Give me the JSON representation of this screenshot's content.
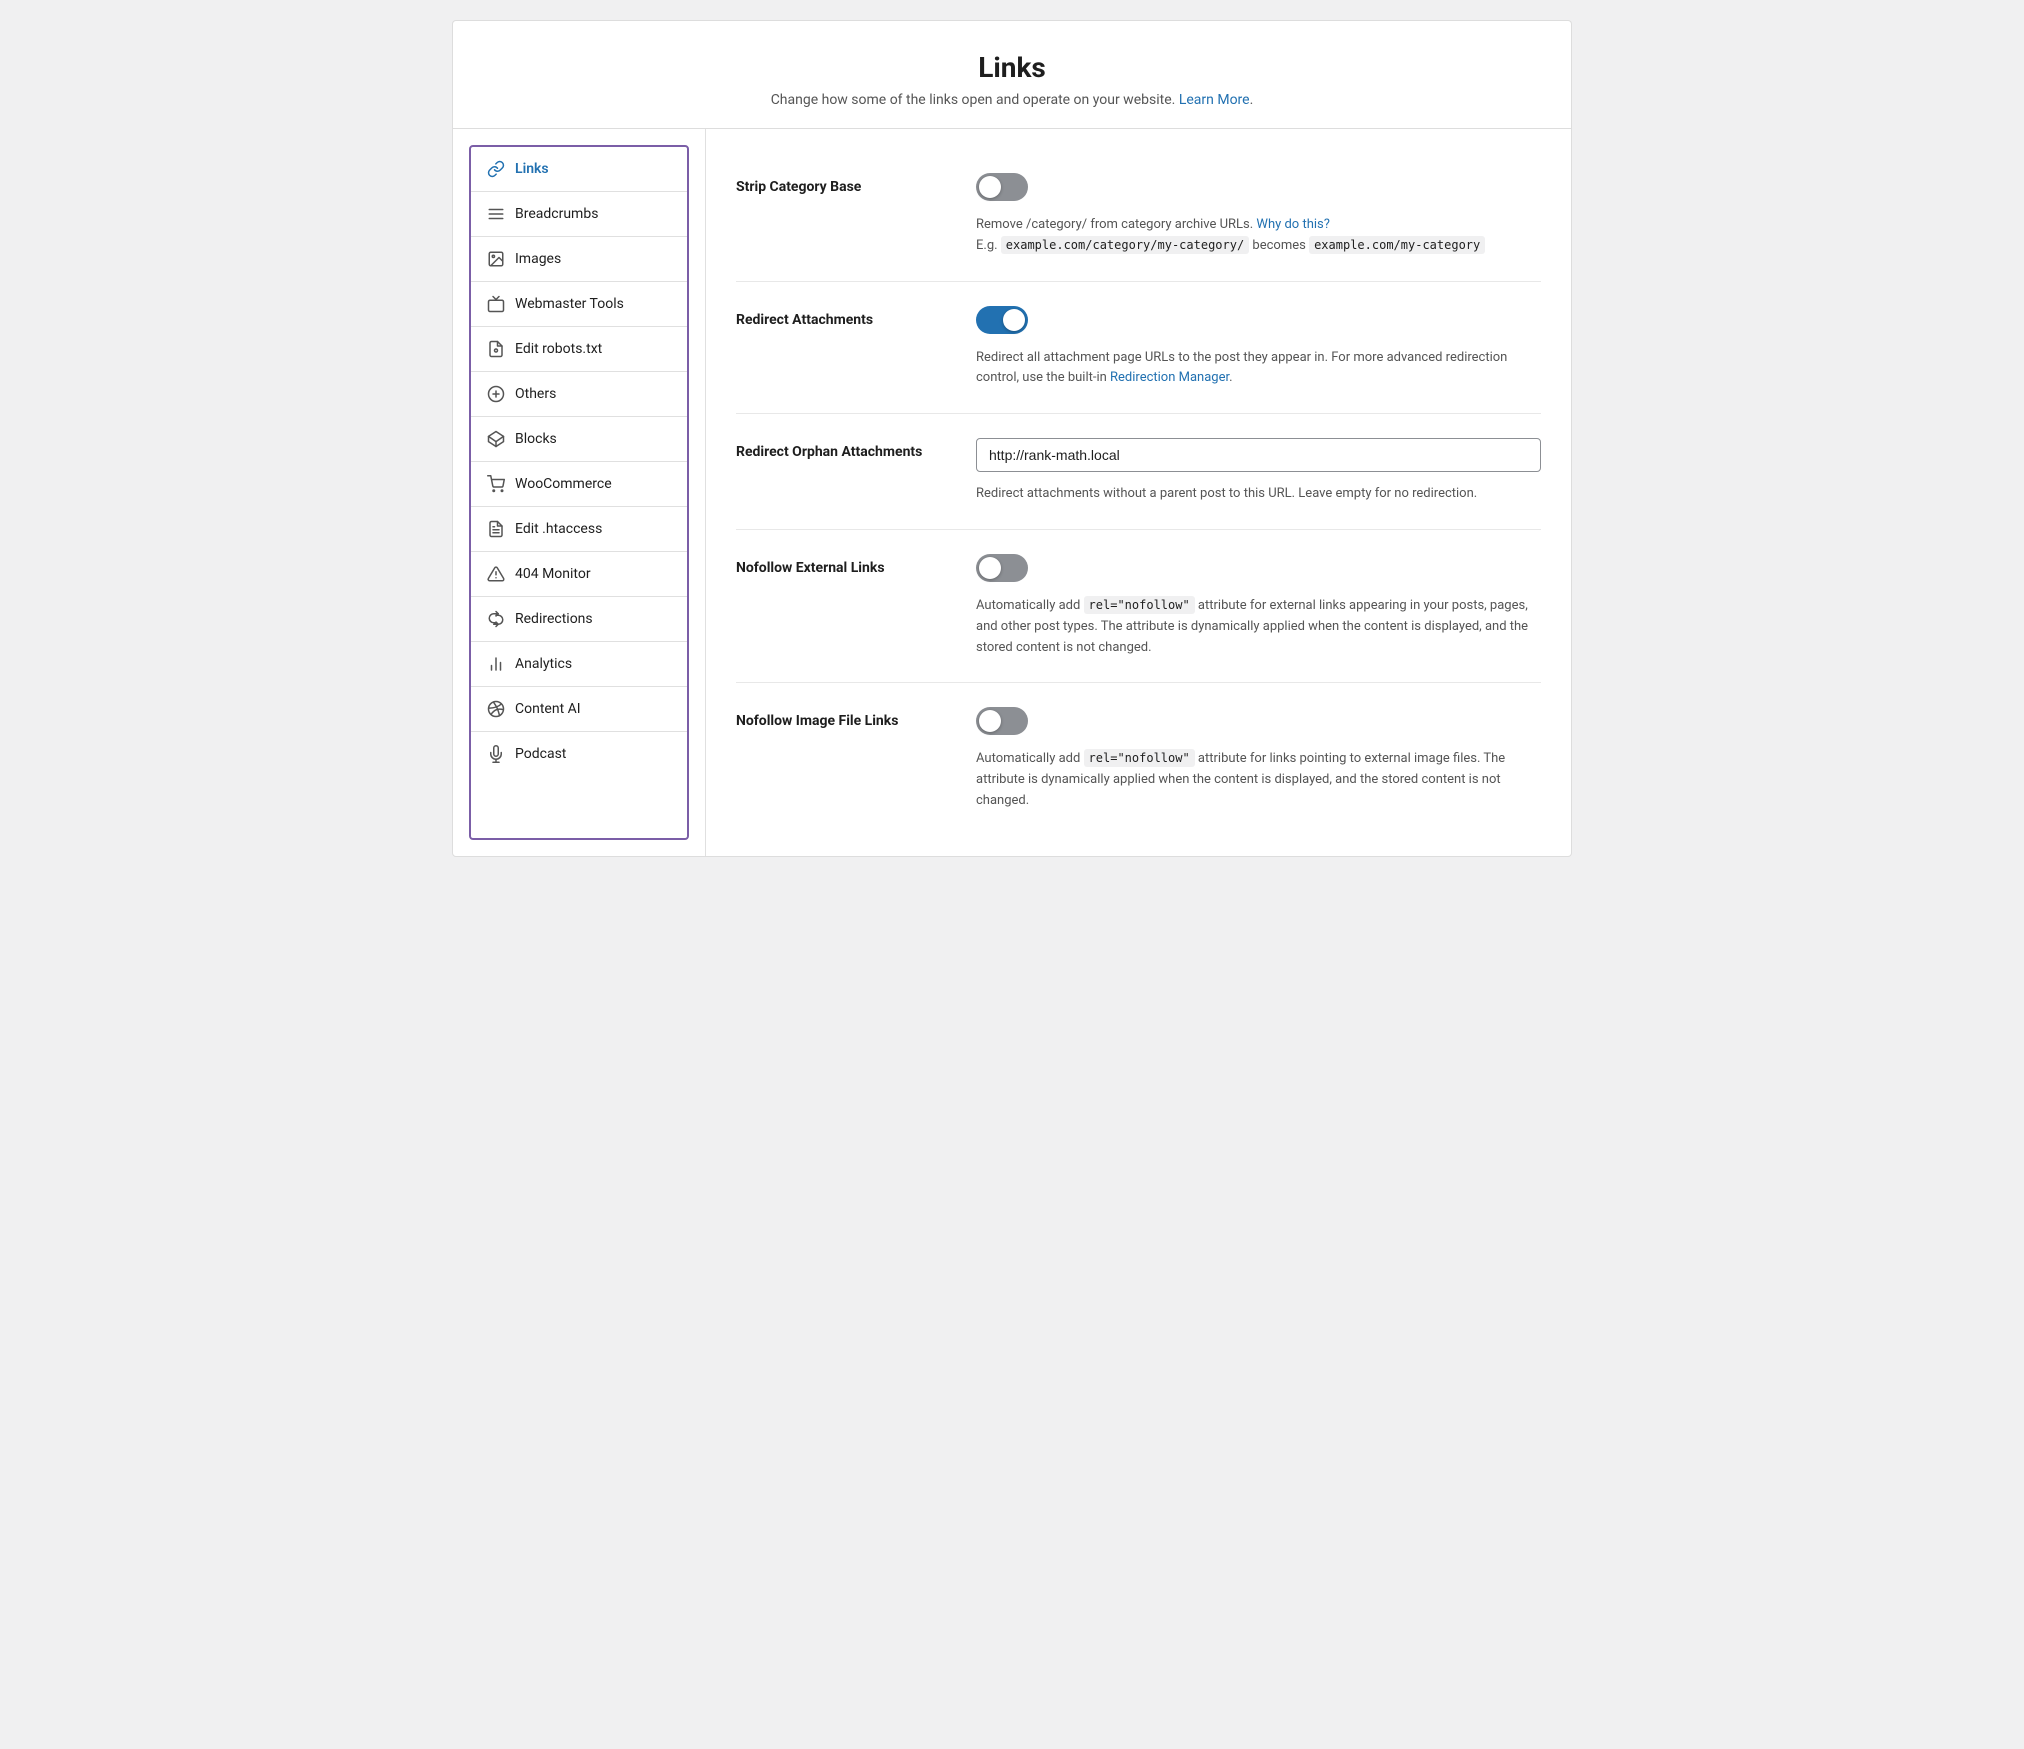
{
  "page": {
    "title": "Links",
    "subtitle": "Change how some of the links open and operate on your website.",
    "learn_more_text": "Learn More",
    "learn_more_url": "#"
  },
  "sidebar": {
    "items": [
      {
        "id": "links",
        "label": "Links",
        "active": true,
        "icon": "links-icon"
      },
      {
        "id": "breadcrumbs",
        "label": "Breadcrumbs",
        "active": false,
        "icon": "breadcrumbs-icon"
      },
      {
        "id": "images",
        "label": "Images",
        "active": false,
        "icon": "images-icon"
      },
      {
        "id": "webmaster-tools",
        "label": "Webmaster Tools",
        "active": false,
        "icon": "webmaster-icon"
      },
      {
        "id": "edit-robots",
        "label": "Edit robots.txt",
        "active": false,
        "icon": "robots-icon"
      },
      {
        "id": "others",
        "label": "Others",
        "active": false,
        "icon": "others-icon"
      },
      {
        "id": "blocks",
        "label": "Blocks",
        "active": false,
        "icon": "blocks-icon"
      },
      {
        "id": "woocommerce",
        "label": "WooCommerce",
        "active": false,
        "icon": "woo-icon"
      },
      {
        "id": "edit-htaccess",
        "label": "Edit .htaccess",
        "active": false,
        "icon": "htaccess-icon"
      },
      {
        "id": "404-monitor",
        "label": "404 Monitor",
        "active": false,
        "icon": "monitor-icon"
      },
      {
        "id": "redirections",
        "label": "Redirections",
        "active": false,
        "icon": "redirections-icon"
      },
      {
        "id": "analytics",
        "label": "Analytics",
        "active": false,
        "icon": "analytics-icon"
      },
      {
        "id": "content-ai",
        "label": "Content AI",
        "active": false,
        "icon": "content-ai-icon"
      },
      {
        "id": "podcast",
        "label": "Podcast",
        "active": false,
        "icon": "podcast-icon"
      }
    ]
  },
  "settings": [
    {
      "id": "strip-category-base",
      "label": "Strip Category Base",
      "type": "toggle",
      "enabled": false,
      "description": "Remove /category/ from category archive URLs.",
      "description_link_text": "Why do this?",
      "description_link_url": "#",
      "description_extra": "E.g. example.com/category/my-category/ becomes example.com/my-category"
    },
    {
      "id": "redirect-attachments",
      "label": "Redirect Attachments",
      "type": "toggle",
      "enabled": true,
      "description": "Redirect all attachment page URLs to the post they appear in. For more advanced redirection control, use the built-in",
      "description_link_text": "Redirection Manager",
      "description_link_url": "#",
      "description_suffix": "."
    },
    {
      "id": "redirect-orphan-attachments",
      "label": "Redirect Orphan Attachments",
      "type": "text",
      "value": "http://rank-math.local",
      "placeholder": "http://rank-math.local",
      "description": "Redirect attachments without a parent post to this URL. Leave empty for no redirection."
    },
    {
      "id": "nofollow-external-links",
      "label": "Nofollow External Links",
      "type": "toggle",
      "enabled": false,
      "description": "Automatically add",
      "code_snippet": "rel=\"nofollow\"",
      "description_cont": "attribute for external links appearing in your posts, pages, and other post types. The attribute is dynamically applied when the content is displayed, and the stored content is not changed."
    },
    {
      "id": "nofollow-image-file-links",
      "label": "Nofollow Image File Links",
      "type": "toggle",
      "enabled": false,
      "description": "Automatically add",
      "code_snippet": "rel=\"nofollow\"",
      "description_cont": "attribute for links pointing to external image files. The attribute is dynamically applied when the content is displayed, and the stored content is not changed."
    }
  ]
}
